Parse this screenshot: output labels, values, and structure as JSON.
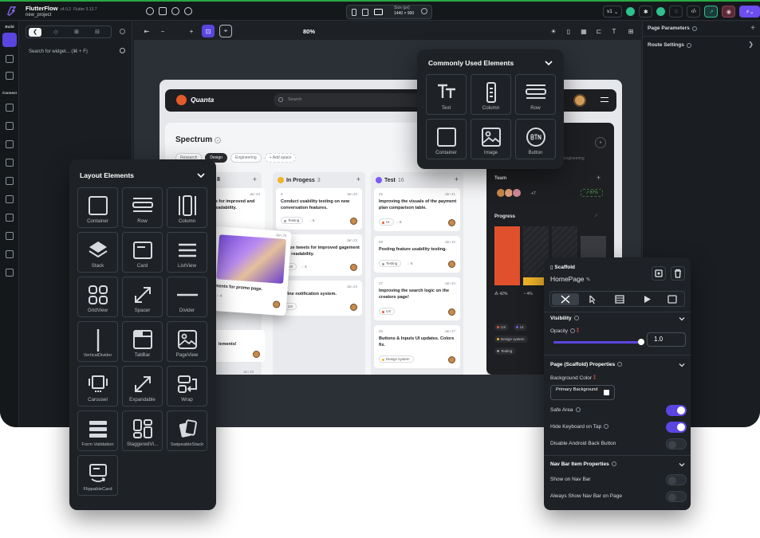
{
  "app": {
    "name": "FlutterFlow",
    "version": "v4.0.2",
    "flutter_version": "Flutter 3.13.7",
    "project": "new_project",
    "rail": {
      "build_label": "Build",
      "connect_label": "Connect"
    },
    "widget_search_placeholder": "Search for widget... (⌘ + F)",
    "zoom": "80%",
    "size_label": "Size (px)",
    "size_value": "1440 × 900",
    "version_select": "v1",
    "right_panel": {
      "page_parameters": "Page Parameters",
      "route_settings": "Route Settings"
    }
  },
  "preview": {
    "brand": "Quanta",
    "search_placeholder": "Search",
    "board_title": "Spectrum",
    "tabs": [
      "Research",
      "Design",
      "Engineering",
      "+ Add space"
    ],
    "columns": [
      {
        "name": "In Progess",
        "count": "3"
      },
      {
        "name": "Test",
        "count": "16"
      }
    ],
    "partial_column": {
      "count": "8",
      "card1_date": "Jan 23",
      "card1_title": "ts for improved and readability.",
      "card2_title": "lements!",
      "card2_date": "Jan 28"
    },
    "cards_col1": [
      {
        "id": "8",
        "date": "Jan 20",
        "title": "Conduct usability testing on new conversation features.",
        "tag": "Testing",
        "comments": "6"
      },
      {
        "id": "",
        "date": "Jan 23",
        "title": "timize tweets for improved gagement and readability.",
        "tag": "UX",
        "comments": "3"
      },
      {
        "id": "",
        "date": "Jan 24",
        "title": "Refine notification system.",
        "tag": "UX",
        "comments": ""
      }
    ],
    "cards_col2": [
      {
        "id": "26",
        "date": "Jan 21",
        "title": "Improving the visuals of the payment plan comparison table.",
        "tag": "UI",
        "comments": "5"
      },
      {
        "id": "69",
        "date": "Jan 22",
        "title": "Posting feature usability testing.",
        "tag": "Testing",
        "comments": "6"
      },
      {
        "id": "27",
        "date": "Jan 24",
        "title": "Improving the search logic on the creators page!",
        "tag": "UX",
        "comments": ""
      },
      {
        "id": "25",
        "date": "Jan 27",
        "title": "Buttons & Inputs UI updates. Colors fix.",
        "tag": "Design system",
        "comments": ""
      }
    ],
    "photo_card": {
      "date": "Jan 25",
      "title": "ments for promo page.",
      "comments": "4"
    },
    "dark_panel": {
      "engineering": "Engineering",
      "team_label": "Team",
      "team_extra": "+7",
      "team_badge": "87%",
      "progress_label": "Progress",
      "stat1": "42%",
      "stat2": "4%",
      "tags": [
        "UX",
        "UI",
        "Design system",
        "Testing"
      ]
    },
    "colors": {
      "orange": "#e0502c",
      "yellow": "#f0b429",
      "purple": "#7c5cf0"
    }
  },
  "common_elements": {
    "title": "Commonly Used Elements",
    "items": [
      "Text",
      "Column",
      "Row",
      "Container",
      "Image",
      "Button"
    ]
  },
  "layout_elements": {
    "title": "Layout Elements",
    "items": [
      "Container",
      "Row",
      "Column",
      "Stack",
      "Card",
      "ListView",
      "GridView",
      "Spacer",
      "Divider",
      "VerticalDivider",
      "TabBar",
      "PageView",
      "Carousel",
      "Expandable",
      "Wrap",
      "Form Validation",
      "StaggeredVi...",
      "SwipeableStack",
      "FlippableCard"
    ]
  },
  "properties": {
    "widget_type": "Scaffold",
    "page_name": "HomePage",
    "visibility_label": "Visibility",
    "opacity_label": "Opacity",
    "opacity_value": "1.0",
    "opacity_fraction": 1.0,
    "page_props_label": "Page (Scaffold) Properties",
    "bg_color_label": "Background Color",
    "bg_color_value": "Primary Background",
    "safe_area_label": "Safe Area",
    "safe_area_on": true,
    "hide_keyboard_label": "Hide Keyboard on Tap",
    "hide_keyboard_on": true,
    "disable_back_label": "Disable Android Back Button",
    "disable_back_on": false,
    "nav_props_label": "Nav Bar Item Properties",
    "show_nav_label": "Show on Nav Bar",
    "show_nav_on": false,
    "always_show_label": "Always Show Nav Bar on Page",
    "always_show_on": false
  }
}
